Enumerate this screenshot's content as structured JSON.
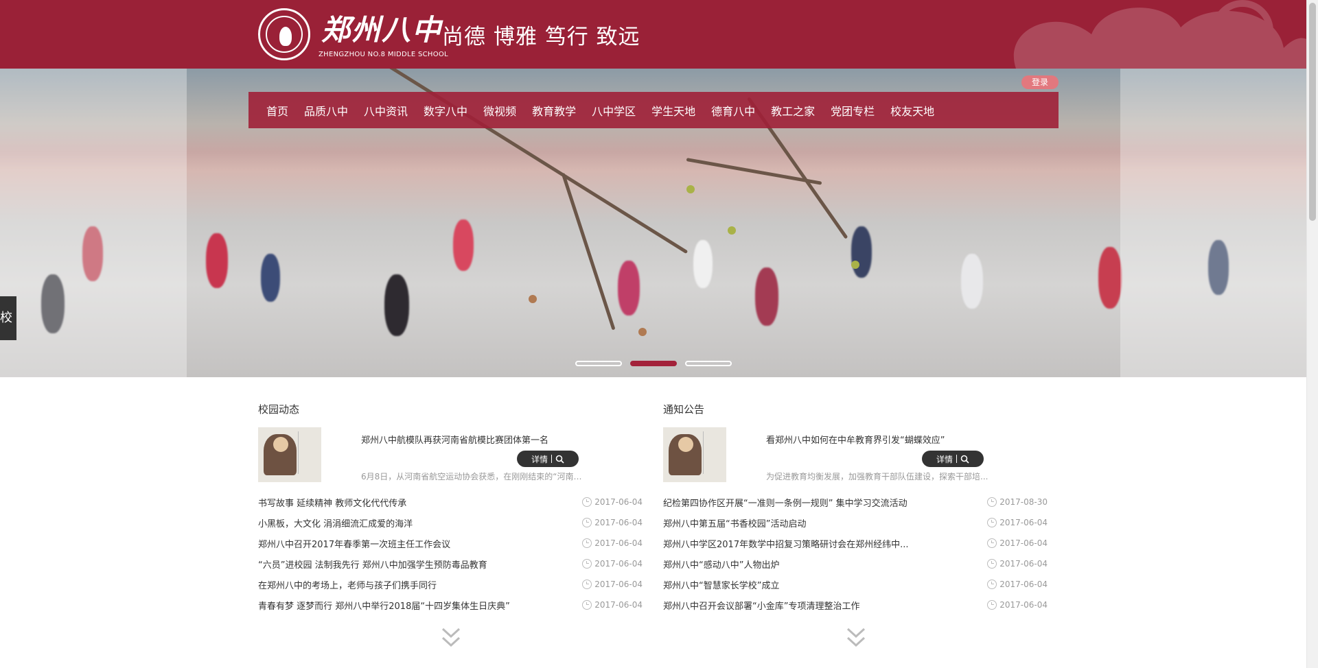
{
  "header": {
    "logo_cn": "郑州八中",
    "logo_en": "ZHENGZHOU NO.8  MIDDLE SCHOOL",
    "motto": "尚德 博雅 笃行 致远",
    "icon": "school-seal-icon",
    "brand_color": "#9a2137"
  },
  "login": {
    "label": "登录"
  },
  "nav": [
    "首页",
    "品质八中",
    "八中资讯",
    "数字八中",
    "微视频",
    "教育教学",
    "八中学区",
    "学生天地",
    "德育八中",
    "教工之家",
    "党团专栏",
    "校友天地"
  ],
  "side_tab": {
    "label": "校"
  },
  "carousel": {
    "active_slide": 2,
    "slide_count": 3
  },
  "campus_news": {
    "title": "校园动态",
    "feature": {
      "title": "郑州八中航模队再获河南省航模比赛团体第一名",
      "summary": "6月8日，从河南省航空运动协会获悉，在刚刚结束的“河南省...",
      "detail_label": "详情"
    },
    "items": [
      {
        "title": "书写故事 延续精神 教师文化代代传承",
        "date": "2017-06-04"
      },
      {
        "title": "小黑板，大文化 涓涓细流汇成爱的海洋",
        "date": "2017-06-04"
      },
      {
        "title": "郑州八中召开2017年春季第一次班主任工作会议",
        "date": "2017-06-04"
      },
      {
        "title": "“六员”进校园 法制我先行 郑州八中加强学生预防毒品教育",
        "date": "2017-06-04"
      },
      {
        "title": "在郑州八中的考场上，老师与孩子们携手同行",
        "date": "2017-06-04"
      },
      {
        "title": "青春有梦 逐梦而行 郑州八中举行2018届“十四岁集体生日庆典”",
        "date": "2017-06-04"
      }
    ]
  },
  "notices": {
    "title": "通知公告",
    "feature": {
      "title": "看郑州八中如何在中牟教育界引发“蝴蝶效应”",
      "summary": "为促进教育均衡发展，加强教育干部队伍建设，探索干部培...",
      "detail_label": "详情"
    },
    "items": [
      {
        "title": "纪检第四协作区开展“一准则一条例一规则” 集中学习交流活动",
        "date": "2017-08-30"
      },
      {
        "title": "郑州八中第五届“书香校园”活动启动",
        "date": "2017-06-04"
      },
      {
        "title": "郑州八中学区2017年数学中招复习策略研讨会在郑州经纬中...",
        "date": "2017-06-04"
      },
      {
        "title": "郑州八中“感动八中”人物出炉",
        "date": "2017-06-04"
      },
      {
        "title": "郑州八中“智慧家长学校”成立",
        "date": "2017-06-04"
      },
      {
        "title": "郑州八中召开会议部署“小金库”专项清理整治工作",
        "date": "2017-06-04"
      }
    ]
  }
}
